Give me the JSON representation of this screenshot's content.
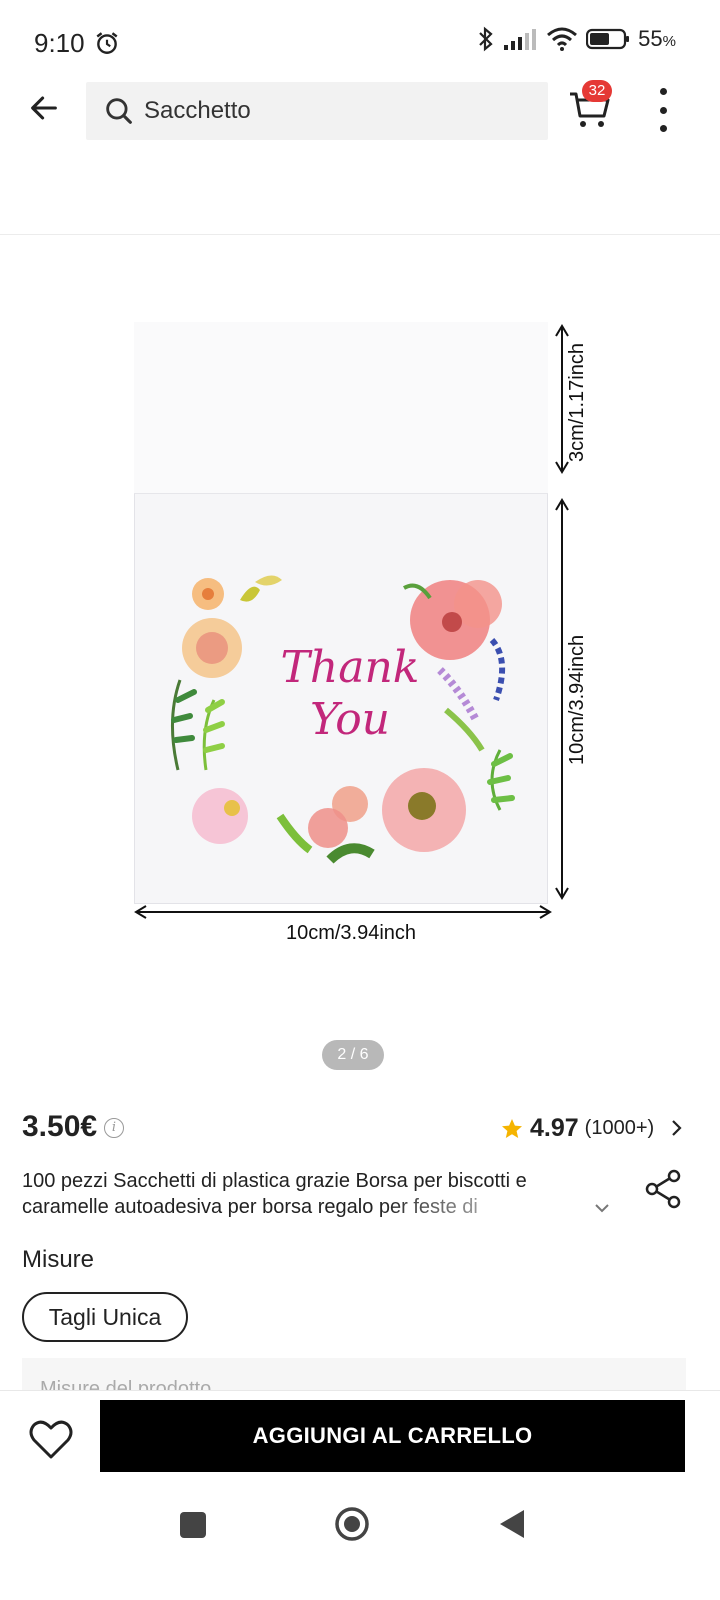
{
  "status_bar": {
    "time": "9:10",
    "battery": "55",
    "battery_unit": "%"
  },
  "top_bar": {
    "search_value": "Sacchetto",
    "cart_count": "32"
  },
  "gallery": {
    "image_text_line1": "Thank",
    "image_text_line2": "You",
    "dim_top_right": "3cm/1.17inch",
    "dim_right": "10cm/3.94inch",
    "dim_bottom": "10cm/3.94inch",
    "page_indicator": "2 / 6"
  },
  "product": {
    "price": "3.50€",
    "rating": "4.97",
    "rating_count": "(1000+)",
    "title": "100 pezzi Sacchetti di plastica grazie Borsa per biscotti e caramelle autoadesiva per borsa regalo per feste di",
    "misure_label": "Misure",
    "size_option": "Tagli Unica",
    "specs_label": "Misure del prodotto"
  },
  "actions": {
    "add_to_cart": "AGGIUNGI AL CARRELLO"
  },
  "colors": {
    "accent": "#000000",
    "badge": "#e53935",
    "star": "#f5b400"
  }
}
